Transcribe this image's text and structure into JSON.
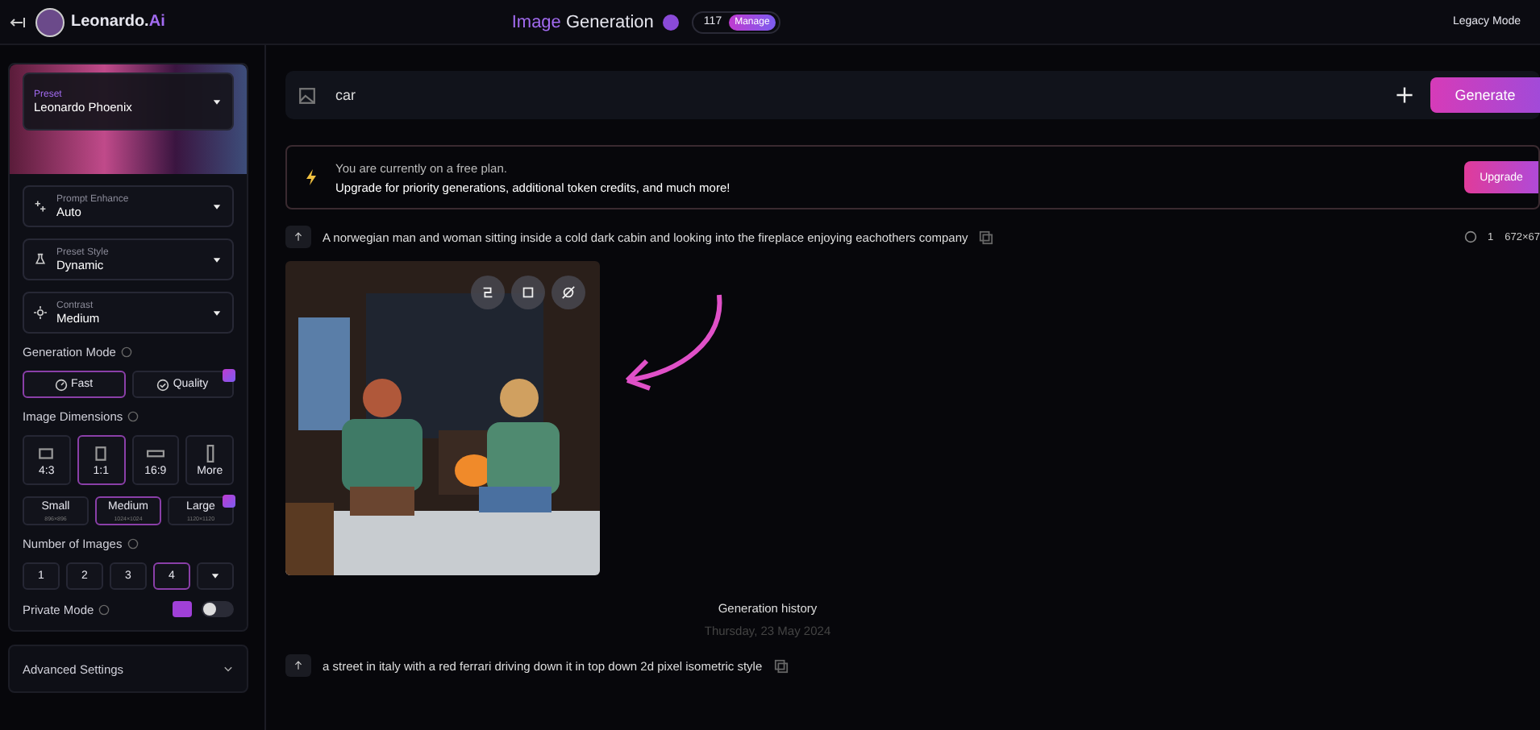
{
  "header": {
    "logo_text": "Leonardo.",
    "logo_accent": "Ai",
    "title_accent": "Image",
    "title": "Generation",
    "tokens": "117",
    "manage": "Manage",
    "legacy": "Legacy Mode"
  },
  "sidebar": {
    "preset": {
      "label": "Preset",
      "value": "Leonardo Phoenix"
    },
    "dropdowns": [
      {
        "kind": "enhance",
        "label": "Prompt Enhance",
        "value": "Auto"
      },
      {
        "kind": "style",
        "label": "Preset Style",
        "value": "Dynamic"
      },
      {
        "kind": "contrast",
        "label": "Contrast",
        "value": "Medium"
      }
    ],
    "generation_mode": {
      "title": "Generation Mode",
      "options": [
        {
          "kind": "fast",
          "label": "Fast",
          "selected": true,
          "premium": false
        },
        {
          "kind": "quality",
          "label": "Quality",
          "selected": false,
          "premium": true
        }
      ]
    },
    "dimensions": {
      "title": "Image Dimensions",
      "ratios": [
        {
          "kind": "wide",
          "label": "4:3",
          "selected": false
        },
        {
          "kind": "square",
          "label": "1:1",
          "selected": true
        },
        {
          "kind": "wider",
          "label": "16:9",
          "selected": false
        },
        {
          "kind": "tall",
          "label": "More",
          "selected": false
        }
      ],
      "sizes": [
        {
          "label": "Small",
          "sub": "896×896",
          "selected": false,
          "premium": false
        },
        {
          "label": "Medium",
          "sub": "1024×1024",
          "selected": true,
          "premium": false
        },
        {
          "label": "Large",
          "sub": "1120×1120",
          "selected": false,
          "premium": true
        }
      ]
    },
    "number_of_images": {
      "title": "Number of Images",
      "options": [
        {
          "label": "1",
          "selected": false
        },
        {
          "label": "2",
          "selected": false
        },
        {
          "label": "3",
          "selected": false
        },
        {
          "label": "4",
          "selected": true
        }
      ]
    },
    "private_mode": {
      "label": "Private Mode",
      "on": false,
      "premium": true
    },
    "advanced": {
      "label": "Advanced Settings"
    }
  },
  "prompt": {
    "value": "car",
    "button": "Generate"
  },
  "banner": {
    "line1": "You are currently on a free plan.",
    "line2": "Upgrade for priority generations, additional token credits, and much more!",
    "button": "Upgrade"
  },
  "generation": {
    "prompt": "A norwegian man and woman sitting inside a cold dark cabin and looking into the fireplace enjoying eachothers company",
    "count": "1",
    "size": "672×67"
  },
  "history": {
    "title": "Generation history",
    "date": "Thursday, 23 May 2024"
  },
  "next_generation": {
    "prompt": "a street in italy with a red ferrari driving down it in top down 2d pixel isometric style"
  }
}
